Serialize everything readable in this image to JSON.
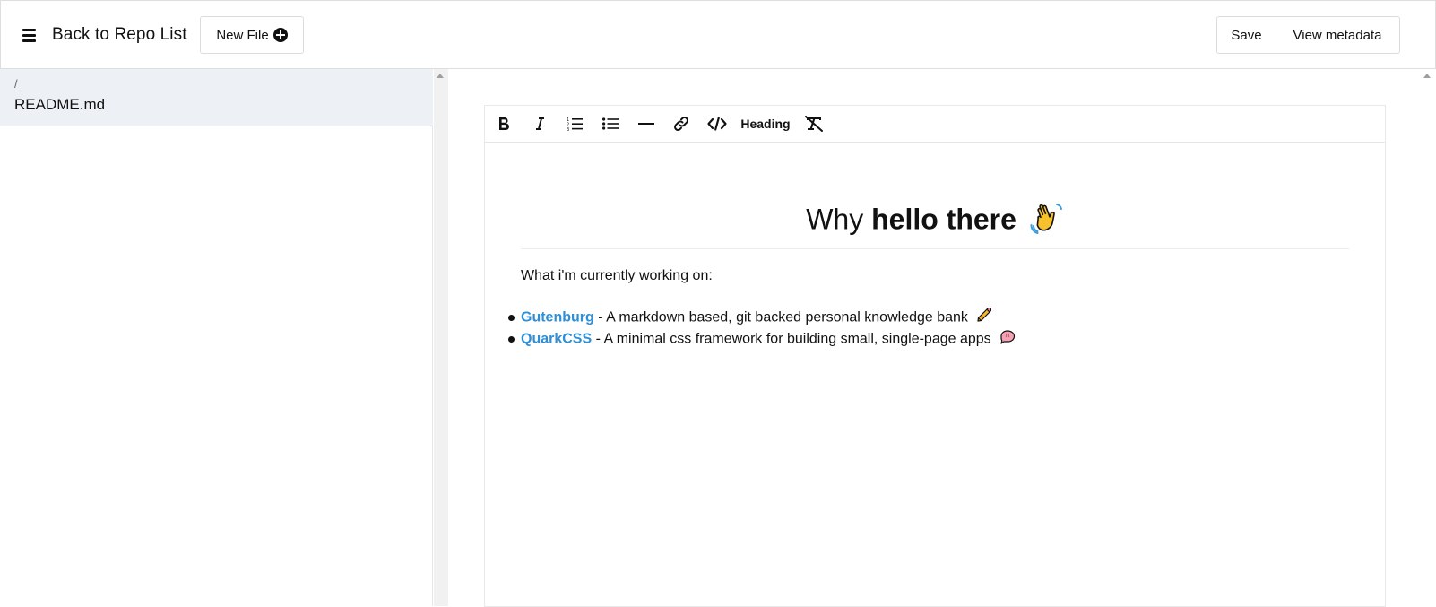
{
  "header": {
    "back_label": "Back to Repo List",
    "new_file_label": "New File",
    "save_label": "Save",
    "view_metadata_label": "View metadata"
  },
  "sidebar": {
    "files": [
      {
        "path": "/",
        "name": "README.md"
      }
    ]
  },
  "editor": {
    "toolbar": {
      "heading_label": "Heading"
    },
    "document": {
      "title_plain": "Why ",
      "title_bold": "hello there",
      "title_emoji": "waving-hand-icon",
      "intro": "What i'm currently working on:",
      "items": [
        {
          "link": "Gutenburg",
          "text": " - A markdown based, git backed personal knowledge bank",
          "emoji": "pencil-icon"
        },
        {
          "link": "QuarkCSS",
          "text": " - A minimal css framework for building small, single-page apps",
          "emoji": "brain-icon"
        }
      ]
    }
  },
  "colors": {
    "link": "#2f8fd6",
    "sidebar_selected": "#edf1f5"
  }
}
